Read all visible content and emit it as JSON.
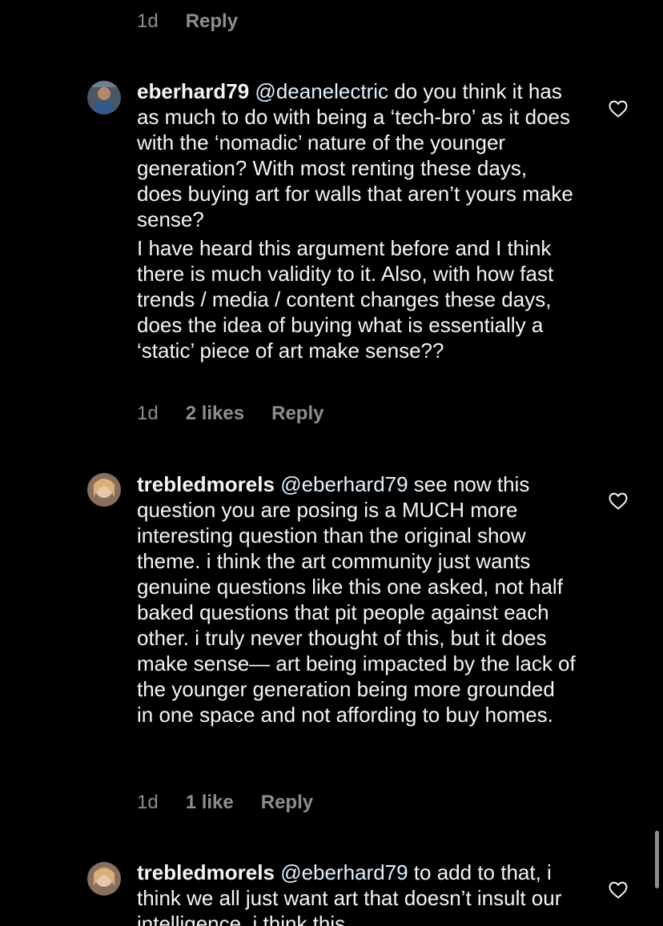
{
  "top_meta": {
    "age": "1d",
    "reply": "Reply"
  },
  "comments": [
    {
      "username": "eberhard79",
      "mention": "@deanelectric",
      "paragraphs": [
        " do you think it has as much to do with being a ‘tech-bro’ as it does with the ‘nomadic’ nature of the younger generation? With most renting these days, does buying art for walls that aren’t yours make sense?",
        "I have heard this argument before and I think there is much validity to it. Also, with how fast trends / media / content changes these days, does the idea of buying what is essentially a ‘static’ piece of art make sense??"
      ],
      "age": "1d",
      "likes": "2 likes",
      "reply": "Reply",
      "avatar_color": "#5b6b7a"
    },
    {
      "username": "trebledmorels",
      "mention": "@eberhard79",
      "paragraphs": [
        " see now this question you are posing is a MUCH more interesting question than the original show theme. i think the art community just wants genuine questions like this one asked, not half baked questions that pit people against each other. i truly never thought of this, but it does make sense— art being impacted by the lack of the younger generation being more grounded in one space and not affording to buy homes."
      ],
      "age": "1d",
      "likes": "1 like",
      "reply": "Reply",
      "avatar_color": "#c9a48a"
    },
    {
      "username": "trebledmorels",
      "mention": "@eberhard79",
      "paragraphs": [
        " to add to that, i think we all just want art that doesn’t insult our intelligence. i think this"
      ],
      "avatar_color": "#c9a48a"
    }
  ],
  "icons": {
    "like": "heart-outline-icon"
  },
  "colors": {
    "background": "#000000",
    "muted": "#8e8e8e",
    "text": "#f5f5f5"
  }
}
